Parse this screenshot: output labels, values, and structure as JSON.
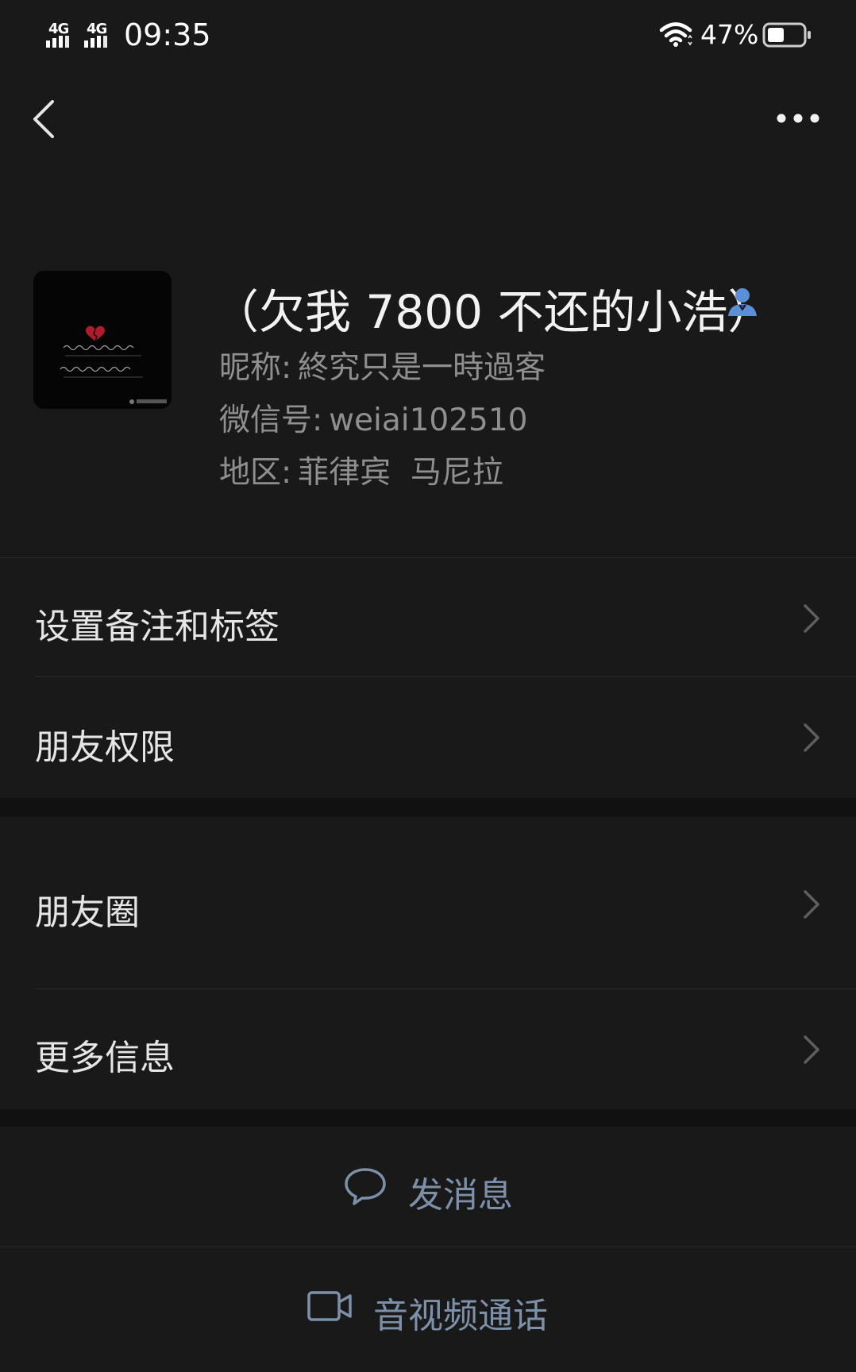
{
  "status_bar": {
    "network_1": "4G",
    "network_2": "4G",
    "time": "09:35",
    "battery_percent": "47%",
    "battery_level": 0.47,
    "icons": [
      "signal-icon",
      "wifi-icon",
      "battery-icon"
    ]
  },
  "nav": {
    "back_icon": "chevron-left-icon",
    "more_icon": "more-dots-icon"
  },
  "profile": {
    "avatar_icon": "avatar-image",
    "display_name": "（欠我 7800 不还的小浩）",
    "contact_icon": "contact-person-icon",
    "nickname_label": "昵称:",
    "nickname_value": "終究只是一時過客",
    "wechat_id_label": "微信号:",
    "wechat_id_value": "weiai102510",
    "region_label": "地区:",
    "region_value": "菲律宾  马尼拉"
  },
  "menu": {
    "set_remark_tags": "设置备注和标签",
    "friend_permissions": "朋友权限",
    "moments": "朋友圈",
    "more_info": "更多信息"
  },
  "actions": {
    "send_message": "发消息",
    "video_call": "音视频通话"
  },
  "colors": {
    "background": "#191919",
    "separator_band": "#111111",
    "action_text": "#7d90a9",
    "contact_icon": "#5b8fd8"
  }
}
